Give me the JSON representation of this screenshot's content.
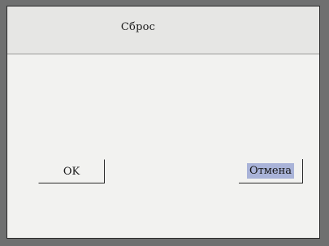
{
  "dialog": {
    "title": "Сброс",
    "ok_label": "OK",
    "cancel_label": "Отмена"
  },
  "colors": {
    "dialog_bg": "#f2f2f0",
    "titlebar_bg": "#e6e6e4",
    "selected_bg": "#a9b3d8",
    "frame": "#2a2a2a"
  }
}
